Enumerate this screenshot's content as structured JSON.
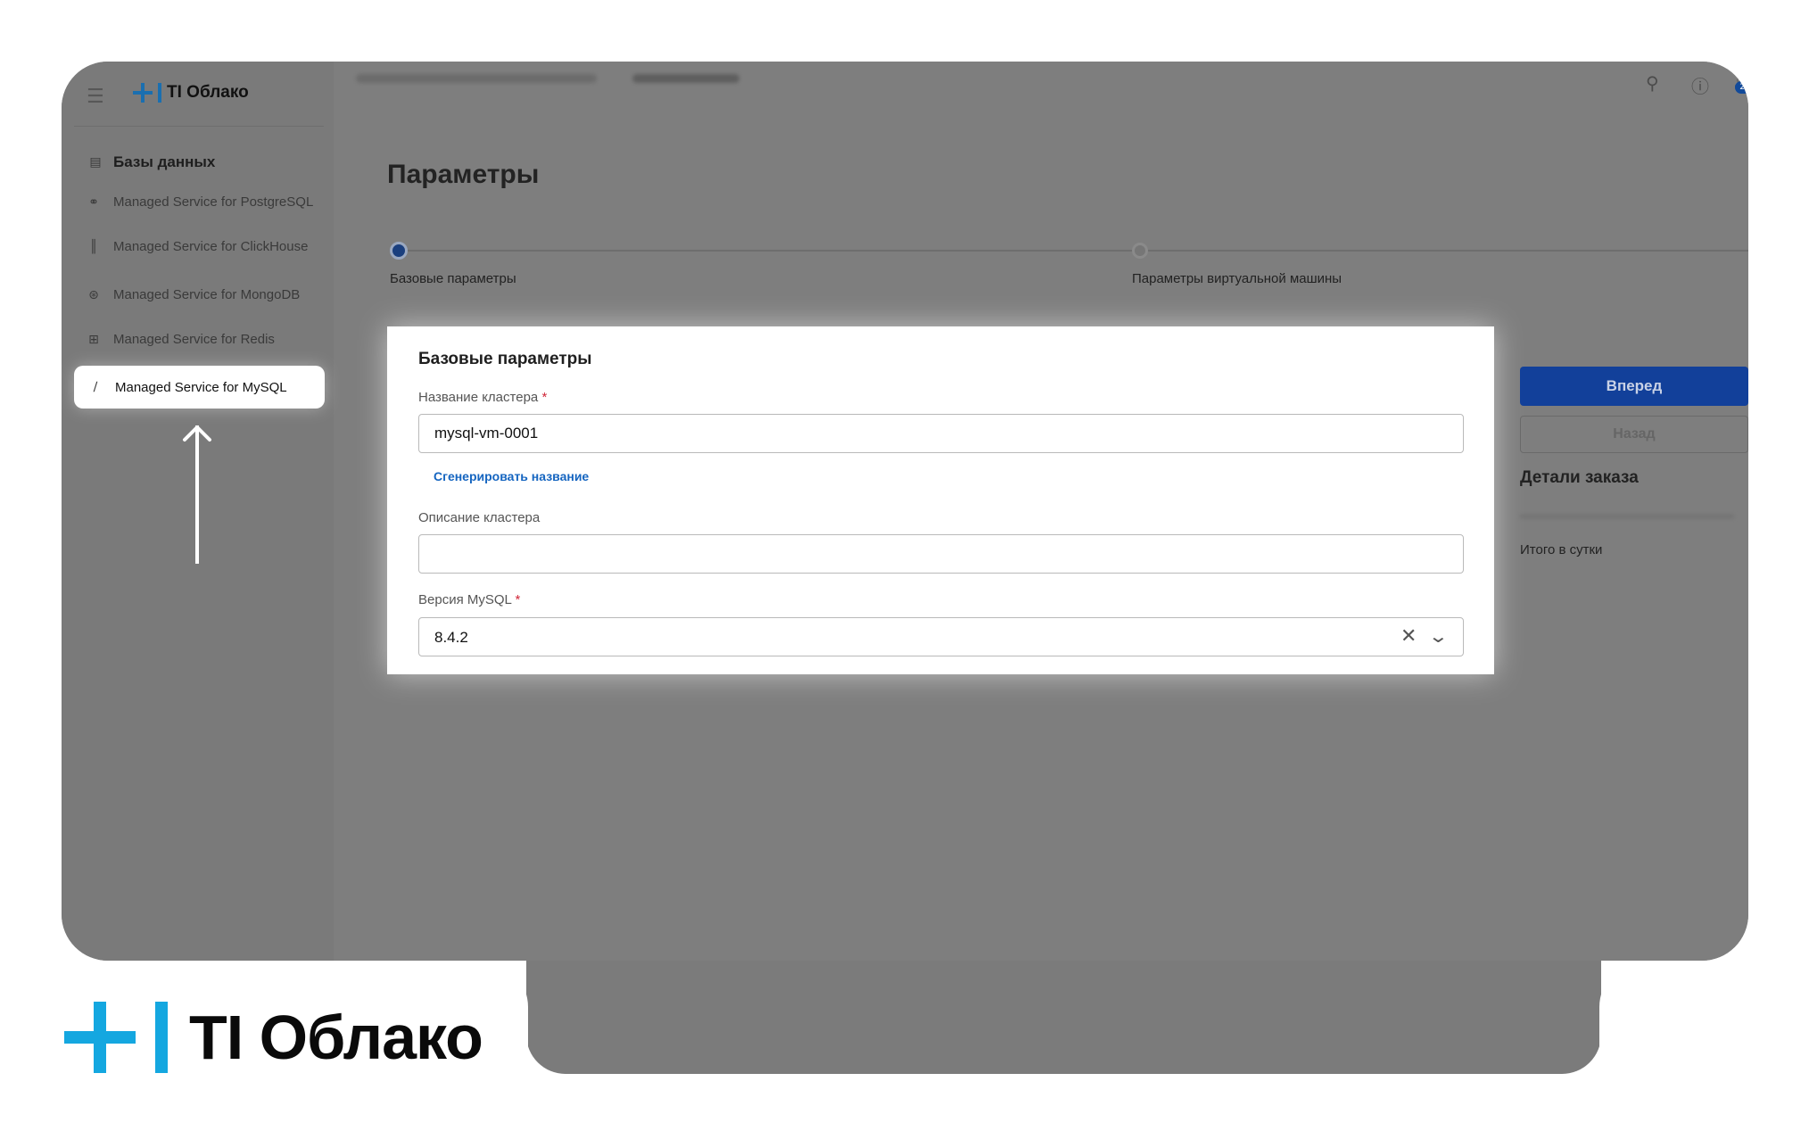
{
  "brand": {
    "name": "TI Облако",
    "accent": "#14a7e0"
  },
  "topbar": {
    "search_icon": "search-icon",
    "info_icon": "info-icon",
    "bell_icon": "bell-icon",
    "badge": "26"
  },
  "sidebar": {
    "section_title": "Базы данных",
    "items": [
      {
        "label": "Managed Service for PostgreSQL",
        "icon": "postgresql-icon"
      },
      {
        "label": "Managed Service for ClickHouse",
        "icon": "clickhouse-icon"
      },
      {
        "label": "Managed Service for MongoDB",
        "icon": "mongodb-icon"
      },
      {
        "label": "Managed Service for Redis",
        "icon": "redis-icon"
      },
      {
        "label": "Managed Service for MySQL",
        "icon": "mysql-icon",
        "active": true
      }
    ]
  },
  "page": {
    "title": "Параметры",
    "steps": [
      {
        "label": "Базовые параметры",
        "state": "active"
      },
      {
        "label": "Параметры виртуальной машины",
        "state": "pending"
      }
    ]
  },
  "form": {
    "card_title": "Базовые параметры",
    "cluster_name_label": "Название кластера",
    "cluster_name_value": "mysql-vm-0001",
    "generate_link": "Сгенерировать название",
    "description_label": "Описание кластера",
    "description_value": "",
    "version_label": "Версия MySQL",
    "version_value": "8.4.2",
    "required_mark": "*"
  },
  "order": {
    "next_label": "Вперед",
    "back_label": "Назад",
    "details_title": "Детали заказа",
    "total_label": "Итого в сутки"
  }
}
